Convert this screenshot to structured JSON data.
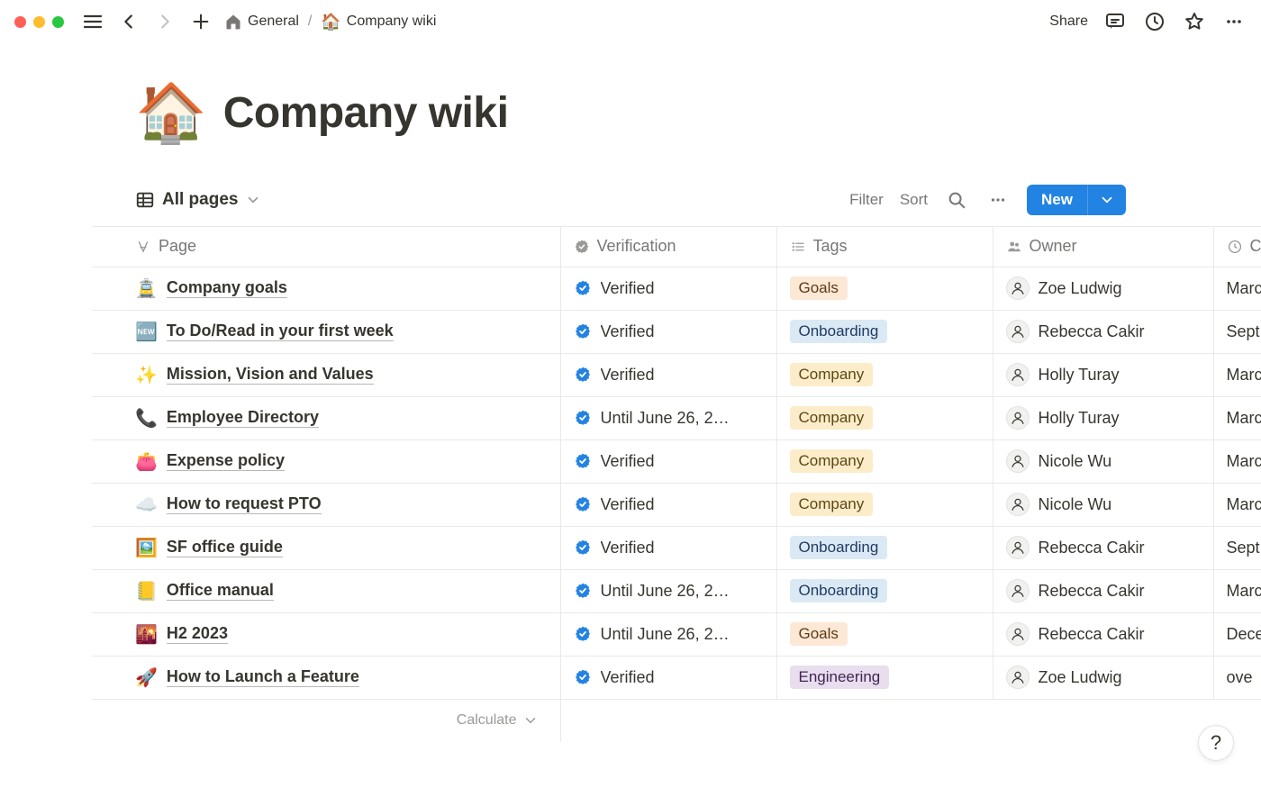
{
  "topbar": {
    "breadcrumb": {
      "parent_label": "General",
      "parent_icon": "home-icon",
      "current_label": "Company wiki",
      "current_emoji": "🏠"
    },
    "share_label": "Share"
  },
  "page": {
    "emoji": "🏠",
    "title": "Company wiki"
  },
  "view": {
    "name": "All pages",
    "filter_label": "Filter",
    "sort_label": "Sort",
    "new_label": "New"
  },
  "columns": {
    "page": "Page",
    "verification": "Verification",
    "tags": "Tags",
    "owner": "Owner",
    "created": "C"
  },
  "rows": [
    {
      "emoji": "🚊",
      "title": "Company goals",
      "verification": "Verified",
      "tag": "Goals",
      "owner": "Zoe Ludwig",
      "created": "Marc"
    },
    {
      "emoji": "🆕",
      "title": "To Do/Read in your first week",
      "verification": "Verified",
      "tag": "Onboarding",
      "owner": "Rebecca Cakir",
      "created": "Sept"
    },
    {
      "emoji": "✨",
      "title": "Mission, Vision and Values",
      "verification": "Verified",
      "tag": "Company",
      "owner": "Holly Turay",
      "created": "Marc"
    },
    {
      "emoji": "📞",
      "title": "Employee Directory",
      "verification": "Until June 26, 2…",
      "tag": "Company",
      "owner": "Holly Turay",
      "created": "Marc"
    },
    {
      "emoji": "👛",
      "title": "Expense policy",
      "verification": "Verified",
      "tag": "Company",
      "owner": "Nicole Wu",
      "created": "Marc"
    },
    {
      "emoji": "☁️",
      "title": "How to request PTO",
      "verification": "Verified",
      "tag": "Company",
      "owner": "Nicole Wu",
      "created": "Marc"
    },
    {
      "emoji": "🖼️",
      "title": "SF office guide",
      "verification": "Verified",
      "tag": "Onboarding",
      "owner": "Rebecca Cakir",
      "created": "Sept"
    },
    {
      "emoji": "📒",
      "title": "Office manual",
      "verification": "Until June 26, 2…",
      "tag": "Onboarding",
      "owner": "Rebecca Cakir",
      "created": "Marc"
    },
    {
      "emoji": "🌇",
      "title": "H2 2023",
      "verification": "Until June 26, 2…",
      "tag": "Goals",
      "owner": "Rebecca Cakir",
      "created": "Dece"
    },
    {
      "emoji": "🚀",
      "title": "How to Launch a Feature",
      "verification": "Verified",
      "tag": "Engineering",
      "owner": "Zoe Ludwig",
      "created": "ove"
    }
  ],
  "calculate_label": "Calculate",
  "help_label": "?"
}
